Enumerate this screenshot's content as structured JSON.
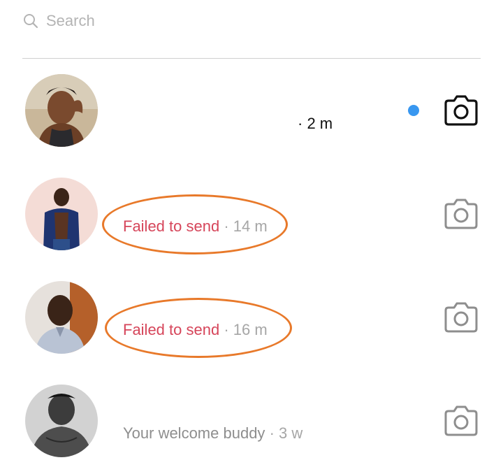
{
  "search": {
    "placeholder": "Search",
    "icon": "search-icon"
  },
  "threads": [
    {
      "avatar": "avatar-photo",
      "preview": "",
      "separator": "·",
      "time": "2 m",
      "unread": true,
      "camera_style": "dark"
    },
    {
      "avatar": "avatar-photo",
      "preview": "Failed to send",
      "separator": "·",
      "time": "14 m",
      "status": "failed",
      "highlighted": true,
      "camera_style": "light"
    },
    {
      "avatar": "avatar-photo",
      "preview": "Failed to send",
      "separator": "·",
      "time": "16 m",
      "status": "failed",
      "highlighted": true,
      "camera_style": "light"
    },
    {
      "avatar": "avatar-photo",
      "preview": "Your welcome buddy",
      "separator": "·",
      "time": "3 w",
      "camera_style": "light"
    }
  ],
  "colors": {
    "failed_text": "#d6455a",
    "muted_text": "#a6a6a6",
    "unread_dot": "#3897f0",
    "highlight_oval": "#e8792a",
    "divider": "#cfcfcf"
  }
}
